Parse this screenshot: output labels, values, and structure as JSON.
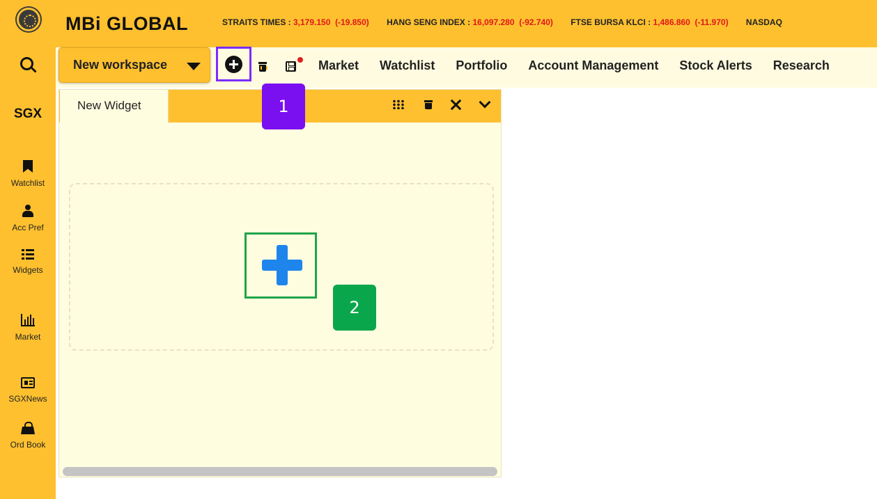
{
  "header": {
    "brand": "MBi GLOBAL",
    "logo": "mbi-globe-logo",
    "ticker": [
      {
        "name": "STRAITS TIMES : ",
        "value": "3,179.150",
        "change": "(-19.850)"
      },
      {
        "name": "HANG SENG INDEX : ",
        "value": "16,097.280",
        "change": "(-92.740)"
      },
      {
        "name": "FTSE BURSA KLCI : ",
        "value": "1,486.860",
        "change": "(-11.970)"
      },
      {
        "name": "NASDAQ",
        "value": "",
        "change": ""
      }
    ]
  },
  "toolbar": {
    "search_icon": "search-icon",
    "workspace_label": "New workspace",
    "add_icon": "plus-circle-icon",
    "delete_icon": "trash-icon",
    "save_icon": "save-icon"
  },
  "menu": [
    "Market",
    "Watchlist",
    "Portfolio",
    "Account Management",
    "Stock Alerts",
    "Research"
  ],
  "sidebar": {
    "exchange": "SGX",
    "items": [
      {
        "label": "Watchlist",
        "icon": "bookmark-icon"
      },
      {
        "label": "Acc Pref",
        "icon": "user-icon"
      },
      {
        "label": "Widgets",
        "icon": "list-icon"
      },
      {
        "label": "Market",
        "icon": "bar-chart-icon"
      },
      {
        "label": "SGXNews",
        "icon": "newspaper-icon"
      },
      {
        "label": "Ord Book",
        "icon": "shopping-bag-icon"
      }
    ]
  },
  "widget": {
    "tab_label": "New Widget",
    "add_widget_icon": "plus-icon"
  },
  "annotations": {
    "badge_1": "1",
    "badge_2": "2"
  },
  "colors": {
    "brand_yellow": "#fec02f",
    "panel_bg": "#fffde0",
    "ticker_red": "#e01818",
    "highlight_purple": "#7a2cff",
    "highlight_green": "#1fa54a",
    "plus_blue": "#1d85ec"
  }
}
